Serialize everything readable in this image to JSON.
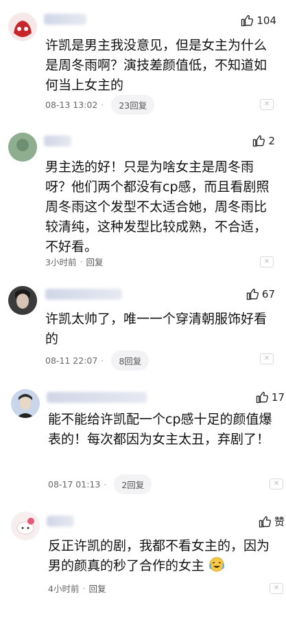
{
  "icons": {
    "like": "thumbs-up-icon",
    "close": "close-icon",
    "emoji": "laughing-tears-emoji-icon"
  },
  "comments": [
    {
      "likes": "104",
      "text": "许凯是男主我没意见，但是女主为什么是周冬雨啊？演技差颜值低，不知道如何当上女主的",
      "time": "08-13 13:02",
      "replies": "23回复"
    },
    {
      "likes": "2",
      "text": "男主选的好！只是为啥女主是周冬雨呀？他们两个都没有cp感，而且看剧照周冬雨这个发型不太适合她，周冬雨比较清纯，这种发型比较成熟，不合适，不好看。",
      "time": "3小时前",
      "replies": "回复"
    },
    {
      "likes": "67",
      "text": "许凯太帅了，唯一一个穿清朝服饰好看的",
      "time": "08-11 22:07",
      "replies": "8回复"
    },
    {
      "likes": "17",
      "text": "能不能给许凯配一个cp感十足的颜值爆表的！每次都因为女主太丑，弃剧了！",
      "time": "08-17 01:13",
      "replies": "2回复"
    },
    {
      "likes": "赞",
      "text": "反正许凯的剧，我都不看女主的，因为男的颜真的秒了合作的女主",
      "time": "4小时前",
      "replies": "回复"
    }
  ],
  "colors": {
    "text": "#111111",
    "meta": "#666666",
    "pill_bg": "#f3f3f5"
  }
}
